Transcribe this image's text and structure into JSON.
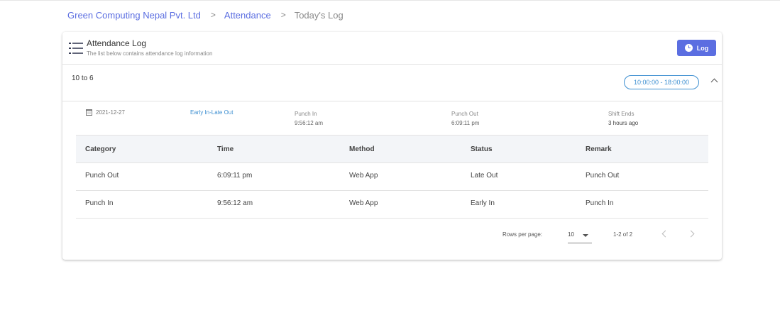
{
  "breadcrumb": {
    "company": "Green Computing Nepal Pvt. Ltd",
    "section": "Attendance",
    "current": "Today's Log",
    "separator": ">"
  },
  "card": {
    "title": "Attendance Log",
    "subtitle": "The list below contains attendance log information",
    "log_button": "Log",
    "accent_color": "#5b6ee1"
  },
  "shift": {
    "name": "10 to 6",
    "time_range": "10:00:00 - 18:00:00"
  },
  "summary": {
    "date": "2021-12-27",
    "type": "Early In-Late Out",
    "punch_in_label": "Punch In",
    "punch_in_value": "9:56:12 am",
    "punch_out_label": "Punch Out",
    "punch_out_value": "6:09:11 pm",
    "shift_ends_label": "Shift Ends",
    "shift_ends_value": "3 hours ago"
  },
  "table": {
    "headers": [
      "Category",
      "Time",
      "Method",
      "Status",
      "Remark"
    ],
    "rows": [
      [
        "Punch Out",
        "6:09:11 pm",
        "Web App",
        "Late Out",
        "Punch Out"
      ],
      [
        "Punch In",
        "9:56:12 am",
        "Web App",
        "Early In",
        "Punch In"
      ]
    ]
  },
  "pagination": {
    "rows_per_page_label": "Rows per page:",
    "rows_per_page": "10",
    "range": "1-2 of 2"
  }
}
